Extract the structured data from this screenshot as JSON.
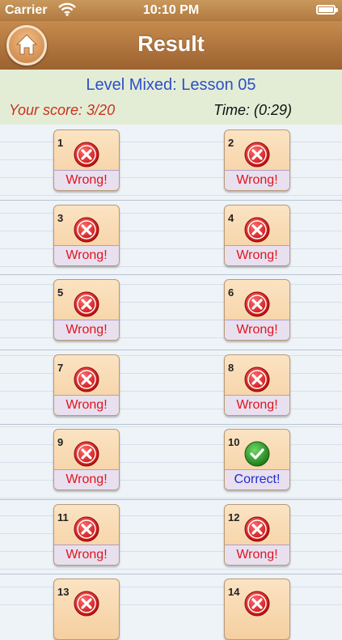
{
  "status_bar": {
    "carrier": "Carrier",
    "time": "10:10 PM"
  },
  "nav": {
    "title": "Result"
  },
  "summary": {
    "lesson": "Level Mixed: Lesson 05",
    "score": "Your score: 3/20",
    "time": "Time: (0:29)"
  },
  "colors": {
    "wrong": "#e0141e",
    "correct": "#1f2ccf",
    "nav": "#b17a40"
  },
  "icons": {
    "home": "home-icon",
    "wrong": "x-circle-icon",
    "correct": "check-circle-icon"
  },
  "results": [
    {
      "num": "1",
      "label": "Wrong!",
      "status": "wrong"
    },
    {
      "num": "2",
      "label": "Wrong!",
      "status": "wrong"
    },
    {
      "num": "3",
      "label": "Wrong!",
      "status": "wrong"
    },
    {
      "num": "4",
      "label": "Wrong!",
      "status": "wrong"
    },
    {
      "num": "5",
      "label": "Wrong!",
      "status": "wrong"
    },
    {
      "num": "6",
      "label": "Wrong!",
      "status": "wrong"
    },
    {
      "num": "7",
      "label": "Wrong!",
      "status": "wrong"
    },
    {
      "num": "8",
      "label": "Wrong!",
      "status": "wrong"
    },
    {
      "num": "9",
      "label": "Wrong!",
      "status": "wrong"
    },
    {
      "num": "10",
      "label": "Correct!",
      "status": "correct"
    },
    {
      "num": "11",
      "label": "Wrong!",
      "status": "wrong"
    },
    {
      "num": "12",
      "label": "Wrong!",
      "status": "wrong"
    },
    {
      "num": "13",
      "label": "",
      "status": "wrong"
    },
    {
      "num": "14",
      "label": "",
      "status": "wrong"
    }
  ]
}
